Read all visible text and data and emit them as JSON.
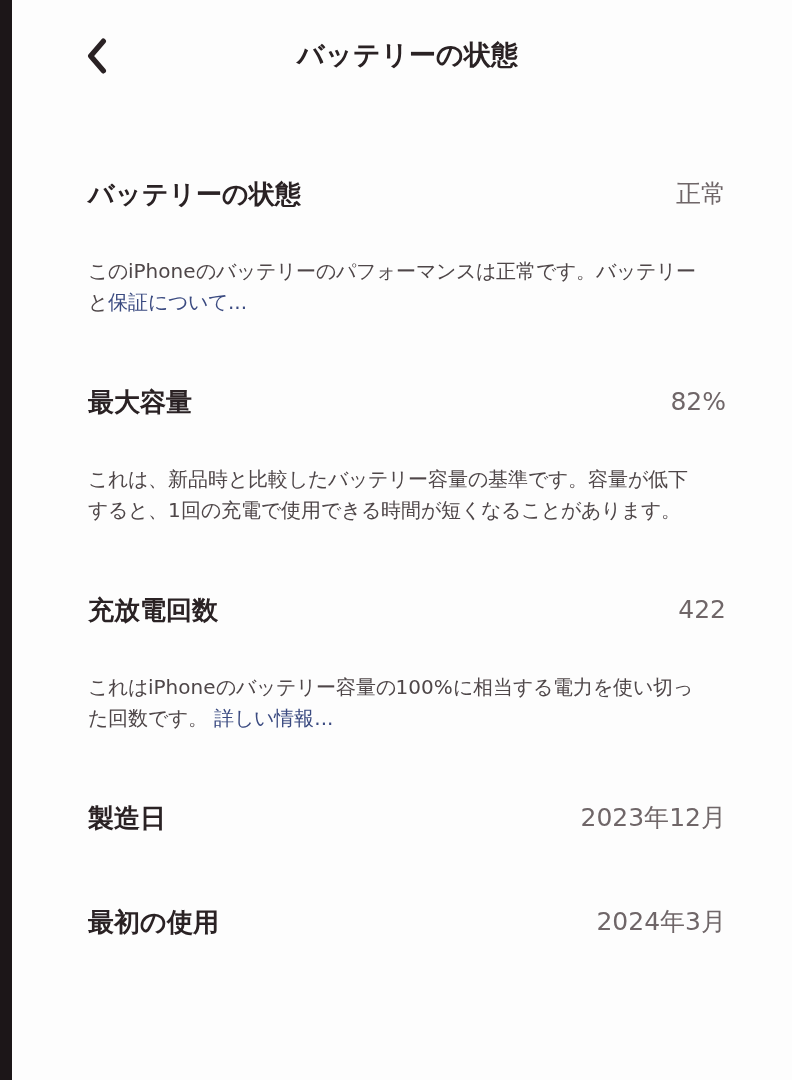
{
  "nav": {
    "title": "バッテリーの状態"
  },
  "sections": [
    {
      "label": "バッテリーの状態",
      "value": "正常",
      "description": {
        "text": "このiPhoneのバッテリーのパフォーマンスは正常です。バッテリーと",
        "link": "保証について..."
      }
    },
    {
      "label": "最大容量",
      "value": "82%",
      "description": {
        "text": "これは、新品時と比較したバッテリー容量の基準です。容量が低下すると、1回の充電で使用できる時間が短くなることがあります。"
      }
    },
    {
      "label": "充放電回数",
      "value": "422",
      "description": {
        "text": "これはiPhoneのバッテリー容量の100%に相当する電力を使い切った回数です。 ",
        "link": "詳しい情報..."
      }
    },
    {
      "label": "製造日",
      "value": "2023年12月"
    },
    {
      "label": "最初の使用",
      "value": "2024年3月"
    }
  ]
}
